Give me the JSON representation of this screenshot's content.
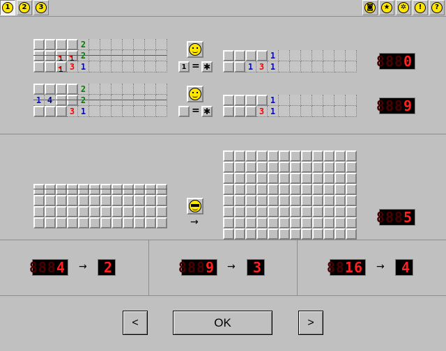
{
  "toolbar": {
    "levels": [
      {
        "label": "1",
        "active": true
      },
      {
        "label": "2",
        "active": false
      },
      {
        "label": "3",
        "active": false
      }
    ],
    "icons": [
      "camera-icon",
      "star-icon",
      "gear-icon",
      "warning-icon",
      "help-icon"
    ]
  },
  "examples": {
    "row1": {
      "before_rows": [
        [
          "",
          "",
          "",
          "",
          "2"
        ],
        [
          "",
          "",
          "f",
          "f",
          "2"
        ],
        [
          "",
          "",
          "f",
          "3",
          "1"
        ]
      ],
      "after_rows": [
        [
          "",
          "",
          "",
          "",
          "1"
        ],
        [
          "",
          "",
          "1",
          "3",
          "1"
        ]
      ],
      "equation_left": "1",
      "equation_eq": "=",
      "counter_lit": "0"
    },
    "row2": {
      "before_rows": [
        [
          "",
          "",
          "",
          "",
          "2"
        ],
        [
          "1",
          "4",
          "",
          "",
          "2"
        ],
        [
          "",
          "",
          "",
          "3",
          "1"
        ]
      ],
      "after_rows": [
        [
          "",
          "",
          "",
          "",
          "1"
        ],
        [
          "",
          "",
          "",
          "3",
          "1"
        ]
      ],
      "equation_eq": "=",
      "counter_lit": "9"
    },
    "row3": {
      "arrow": "→",
      "counter_lit": "5"
    }
  },
  "counters": [
    {
      "from_lit": "4",
      "to_lit": "2",
      "arrow": "→"
    },
    {
      "from_lit": "9",
      "to_lit": "3",
      "arrow": "→"
    },
    {
      "from_lit": "16",
      "to_lit": "4",
      "arrow": "→"
    }
  ],
  "nav": {
    "prev": "<",
    "ok": "OK",
    "next": ">"
  },
  "colors": {
    "face": "#ffe600",
    "lcd_on": "#ff2020",
    "lcd_off": "#4a0000",
    "bg": "#c0c0c0"
  }
}
